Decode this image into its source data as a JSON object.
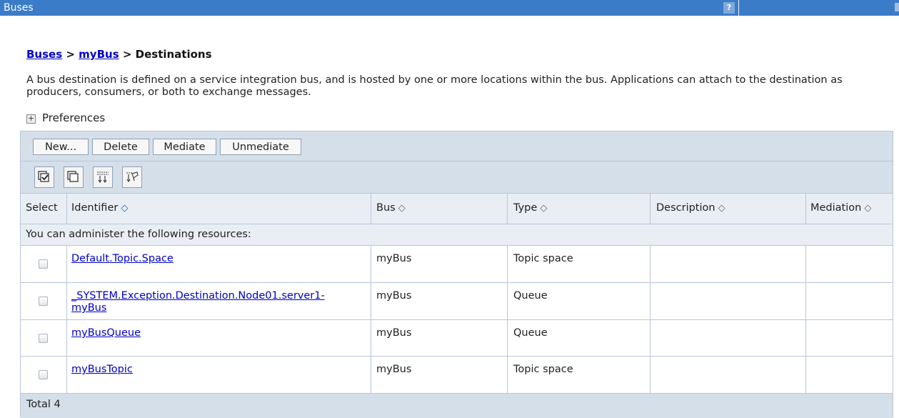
{
  "window": {
    "title": "Buses",
    "help_icon": "?"
  },
  "breadcrumb": {
    "link1": "Buses",
    "sep1": " > ",
    "link2": "myBus",
    "sep2": " > ",
    "current": "Destinations"
  },
  "description": "A bus destination is defined on a service integration bus, and is hosted by one or more locations within the bus. Applications can attach to the destination as producers, consumers, or both to exchange messages.",
  "preferences": {
    "label": "Preferences",
    "expand_icon": "+"
  },
  "toolbar": {
    "new_label": "New...",
    "delete_label": "Delete",
    "mediate_label": "Mediate",
    "unmediate_label": "Unmediate"
  },
  "icon_toolbar": [
    "select-all-icon",
    "deselect-all-icon",
    "show-filter-icon",
    "clear-filter-icon"
  ],
  "table": {
    "columns": [
      "Select",
      "Identifier",
      "Bus",
      "Type",
      "Description",
      "Mediation"
    ],
    "sort_icon": "◇",
    "admin_note": "You can administer the following resources:",
    "rows": [
      {
        "identifier": "Default.Topic.Space",
        "identifier_line2": "",
        "bus": "myBus",
        "type": "Topic space",
        "description": "",
        "mediation": ""
      },
      {
        "identifier": "_SYSTEM.Exception.Destination.Node01.server1-",
        "identifier_line2": "myBus",
        "bus": "myBus",
        "type": "Queue",
        "description": "",
        "mediation": ""
      },
      {
        "identifier": "myBusQueue",
        "identifier_line2": "",
        "bus": "myBus",
        "type": "Queue",
        "description": "",
        "mediation": ""
      },
      {
        "identifier": "myBusTopic",
        "identifier_line2": "",
        "bus": "myBus",
        "type": "Topic space",
        "description": "",
        "mediation": ""
      }
    ],
    "total": "Total 4"
  },
  "colors": {
    "titlebar": "#3b7cc9",
    "link": "#0000c8",
    "toolbar_bg": "#d5dfea",
    "header_bg": "#e9eef4",
    "border": "#b8c5d8"
  }
}
